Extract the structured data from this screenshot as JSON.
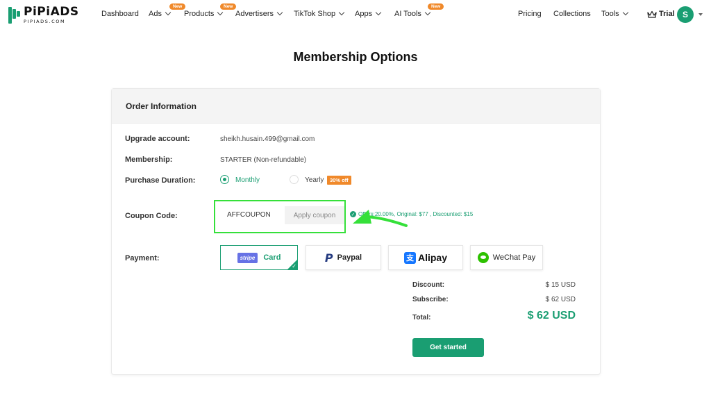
{
  "brand": {
    "name": "PiPiADS",
    "domain": "PIPIADS.COM"
  },
  "nav": {
    "items": [
      {
        "label": "Dashboard",
        "dropdown": false,
        "badge": ""
      },
      {
        "label": "Ads",
        "dropdown": true,
        "badge": "New"
      },
      {
        "label": "Products",
        "dropdown": true,
        "badge": "New"
      },
      {
        "label": "Advertisers",
        "dropdown": true,
        "badge": ""
      },
      {
        "label": "TikTok Shop",
        "dropdown": true,
        "badge": ""
      },
      {
        "label": "Apps",
        "dropdown": true,
        "badge": ""
      },
      {
        "label": "AI Tools",
        "dropdown": true,
        "badge": "New"
      }
    ],
    "right": [
      {
        "label": "Pricing"
      },
      {
        "label": "Collections"
      },
      {
        "label": "Tools"
      }
    ],
    "plan": "Trial",
    "avatar_initial": "S"
  },
  "page": {
    "title": "Membership Options"
  },
  "order": {
    "header": "Order Information",
    "upgrade_label": "Upgrade account:",
    "upgrade_value": "sheikh.husain.499@gmail.com",
    "membership_label": "Membership:",
    "membership_value": "STARTER (Non-refundable)",
    "duration_label": "Purchase Duration:",
    "duration_options": [
      {
        "label": "Monthly",
        "selected": true
      },
      {
        "label": "Yearly",
        "selected": false
      }
    ],
    "yearly_badge": "30% off",
    "coupon_label": "Coupon Code:",
    "coupon_value": "AFFCOUPON",
    "apply_label": "Apply coupon",
    "offers_text": "Offers:20.00%, Original: $77 , Discounted: $15",
    "payment_label": "Payment:",
    "payment_methods": [
      {
        "label": "Card",
        "logo": "stripe",
        "selected": true
      },
      {
        "label": "Paypal",
        "logo": "P",
        "selected": false
      },
      {
        "label": "Alipay",
        "logo": "支",
        "selected": false
      },
      {
        "label": "WeChat Pay",
        "selected": false
      }
    ],
    "summary": {
      "discount_label": "Discount:",
      "discount_value": "$ 15 USD",
      "subscribe_label": "Subscribe:",
      "subscribe_value": "$ 62 USD",
      "total_label": "Total:",
      "total_value": "$ 62 USD"
    },
    "cta_label": "Get started"
  },
  "colors": {
    "accent": "#1a9e72",
    "badge": "#f0892a",
    "highlight": "#35e03a",
    "stripe": "#6772e5"
  }
}
